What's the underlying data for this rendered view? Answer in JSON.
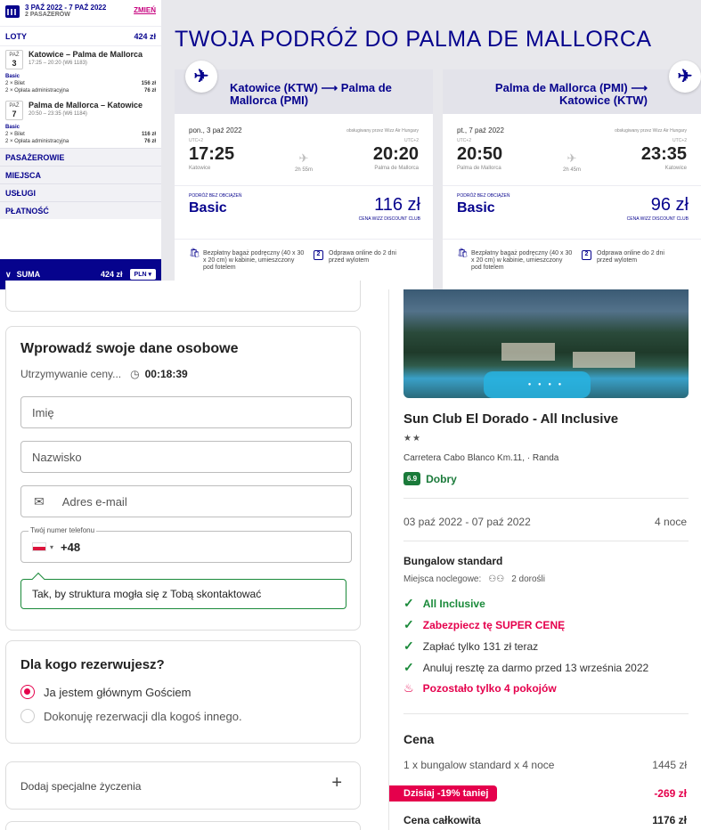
{
  "sidebar": {
    "dates": "3 PAŹ 2022 - 7 PAŹ 2022",
    "passengers": "2 PASAŻERÓW",
    "change": "ZMIEŃ",
    "flights_label": "LOTY",
    "flights_total": "424 zł",
    "segments": [
      {
        "month": "PAŹ",
        "day": "3",
        "route": "Katowice – Palma de Mallorca",
        "times": "17:25 – 20:20 (W6 1183)",
        "fare": "Basic",
        "lines": [
          {
            "label": "2 × Bilet",
            "price": "156 zł"
          },
          {
            "label": "2 × Opłata administracyjna",
            "price": "76 zł"
          }
        ]
      },
      {
        "month": "PAŹ",
        "day": "7",
        "route": "Palma de Mallorca – Katowice",
        "times": "20:50 – 23:35 (W6 1184)",
        "fare": "Basic",
        "lines": [
          {
            "label": "2 × Bilet",
            "price": "116 zł"
          },
          {
            "label": "2 × Opłata administracyjna",
            "price": "76 zł"
          }
        ]
      }
    ],
    "sections": [
      "PASAŻEROWIE",
      "MIEJSCA",
      "USŁUGI",
      "PŁATNOŚĆ"
    ],
    "total_label": "SUMA",
    "total_amount": "424 zł",
    "currency": "PLN"
  },
  "trip_title": "TWOJA PODRÓŻ DO PALMA DE MALLORCA",
  "flights": [
    {
      "route": "Katowice (KTW) ⟶ Palma de Mallorca (PMI)",
      "day": "pon., 3 paź 2022",
      "operator": "obsługiwany przez Wizz Air Hungary",
      "dep_time": "17:25",
      "arr_time": "20:20",
      "utc": "UTC+2",
      "dep_city": "Katowice",
      "arr_city": "Palma de Mallorca",
      "duration": "2h 55m",
      "fare_label": "PODRÓŻ BEZ OBCIĄŻEŃ",
      "fare_name": "Basic",
      "price": "116 zł",
      "club": "CENA WIZZ DISCOUNT CLUB",
      "perk1": "Bezpłatny bagaż podręczny (40 x 30 x 20 cm) w kabinie, umieszczony pod fotelem",
      "perk2_num": "2",
      "perk2": "Odprawa online do 2 dni przed wylotem"
    },
    {
      "route": "Palma de Mallorca (PMI) ⟶ Katowice (KTW)",
      "day": "pt., 7 paź 2022",
      "operator": "obsługiwany przez Wizz Air Hungary",
      "dep_time": "20:50",
      "arr_time": "23:35",
      "utc": "UTC+2",
      "dep_city": "Palma de Mallorca",
      "arr_city": "Katowice",
      "duration": "2h 45m",
      "fare_label": "PODRÓŻ BEZ OBCIĄŻEŃ",
      "fare_name": "Basic",
      "price": "96 zł",
      "club": "CENA WIZZ DISCOUNT CLUB",
      "perk1": "Bezpłatny bagaż podręczny (40 x 30 x 20 cm) w kabinie, umieszczony pod fotelem",
      "perk2_num": "2",
      "perk2": "Odprawa online do 2 dni przed wylotem"
    }
  ],
  "personal": {
    "title": "Wprowadź swoje dane osobowe",
    "hold_label": "Utrzymywanie ceny...",
    "timer": "00:18:39",
    "first_name_ph": "Imię",
    "last_name_ph": "Nazwisko",
    "email_ph": "Adres e-mail",
    "phone_label": "Twój numer telefonu",
    "phone_prefix": "+48",
    "tooltip": "Tak, by struktura mogła się z Tobą skontaktować"
  },
  "booking_for": {
    "title": "Dla kogo rezerwujesz?",
    "opt1": "Ja jestem głównym Gościem",
    "opt2": "Dokonuję rezerwacji dla kogoś innego."
  },
  "special": {
    "label": "Dodaj specjalne życzenia",
    "plus": "+"
  },
  "hotel": {
    "name": "Sun Club El Dorado - All Inclusive",
    "stars": "★★",
    "address": "Carretera Cabo Blanco Km.11, · Randa",
    "rating": "6.9",
    "rating_label": "Dobry",
    "dates": "03 paź 2022 - 07 paź 2022",
    "nights": "4 noce",
    "room": "Bungalow standard",
    "beds_label": "Miejsca noclegowe:",
    "guests": "2 dorośli",
    "features": [
      "All Inclusive",
      "Zabezpiecz tę SUPER CENĘ",
      "Zapłać tylko 131 zł teraz",
      "Anuluj resztę za darmo przed 13 września 2022"
    ],
    "rooms_left": "Pozostało tylko 4 pokojów",
    "price_title": "Cena",
    "line_label": "1 x bungalow standard x 4 noce",
    "line_price": "1445 zł",
    "discount_label": "Dzisiaj -19% taniej",
    "discount_value": "-269 zł",
    "total_label": "Cena całkowita",
    "total_value": "1176 zł"
  },
  "colors": {
    "wizz_blue": "#06038d",
    "wizz_pink": "#c6007e",
    "accent_red": "#e5004c",
    "green": "#1a8a3a"
  }
}
